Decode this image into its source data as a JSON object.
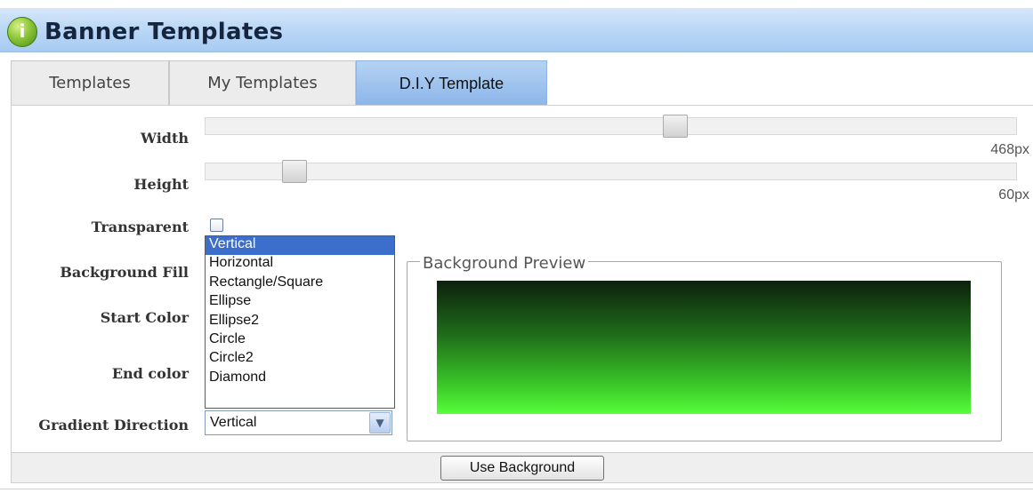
{
  "header": {
    "title": "Banner Templates",
    "icon": "info-icon",
    "icon_glyph": "i"
  },
  "tabs": [
    {
      "label": "Templates",
      "active": false
    },
    {
      "label": "My Templates",
      "active": false
    },
    {
      "label": "D.I.Y Template",
      "active": true
    }
  ],
  "form": {
    "width": {
      "label": "Width",
      "value": "468px",
      "slider_fraction": 0.58
    },
    "height": {
      "label": "Height",
      "value": "60px",
      "slider_fraction": 0.11
    },
    "transparent": {
      "label": "Transparent",
      "checked": false
    },
    "background_fill_label": "Background Fill",
    "start_color_label": "Start Color",
    "end_color_label": "End color",
    "gradient_direction": {
      "label": "Gradient Direction",
      "value": "Vertical",
      "options": [
        "Vertical",
        "Horizontal",
        "Rectangle/Square",
        "Ellipse",
        "Ellipse2",
        "Circle",
        "Circle2",
        "Diamond"
      ],
      "highlighted": "Vertical"
    }
  },
  "preview": {
    "legend": "Background Preview",
    "start_color": "#0d200d",
    "end_color": "#55ff3a"
  },
  "footer": {
    "button_label": "Use Background"
  },
  "colors": {
    "active_tab": "#8cb6ea",
    "title_bar": "#bcd8f6",
    "list_highlight": "#3c6ecc"
  }
}
